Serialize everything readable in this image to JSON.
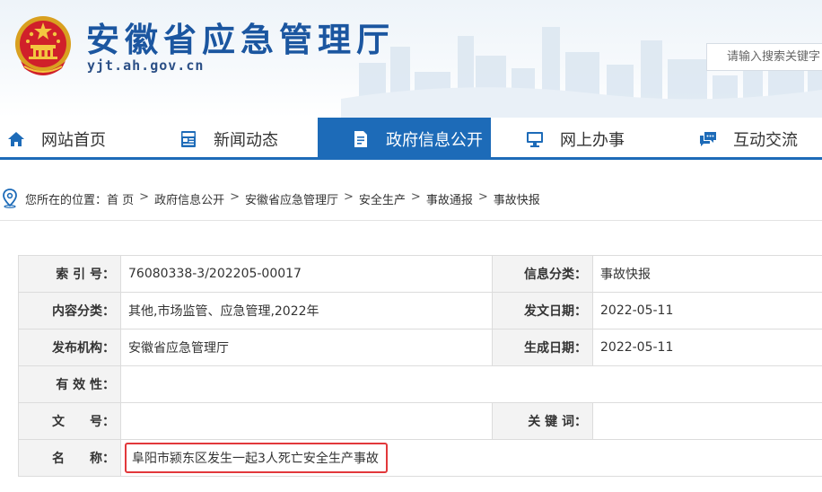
{
  "header": {
    "title": "安徽省应急管理厅",
    "domain": "yjt.ah.gov.cn",
    "search_placeholder": "请输入搜索关键字"
  },
  "nav": {
    "items": [
      {
        "label": "网站首页",
        "icon": "home-icon",
        "active": false
      },
      {
        "label": "新闻动态",
        "icon": "news-icon",
        "active": false
      },
      {
        "label": "政府信息公开",
        "icon": "document-icon",
        "active": true
      },
      {
        "label": "网上办事",
        "icon": "monitor-icon",
        "active": false
      },
      {
        "label": "互动交流",
        "icon": "chat-icon",
        "active": false
      }
    ],
    "accent_color": "#1d6bb8"
  },
  "breadcrumb": {
    "prefix": "您所在的位置：",
    "items": [
      "首 页",
      "政府信息公开",
      "安徽省应急管理厅",
      "安全生产",
      "事故通报",
      "事故快报"
    ]
  },
  "info": {
    "index_label": "索 引 号",
    "index_value": "76080338-3/202205-00017",
    "category_label": "信息分类",
    "category_value": "事故快报",
    "content_label": "内容分类",
    "content_value": "其他,市场监管、应急管理,2022年",
    "issue_date_label": "发文日期",
    "issue_date_value": "2022-05-11",
    "publisher_label": "发布机构",
    "publisher_value": "安徽省应急管理厅",
    "created_label": "生成日期",
    "created_value": "2022-05-11",
    "validity_label": "有 效 性",
    "validity_value": "",
    "docno_label": "文　　号",
    "docno_value": "",
    "keywords_label": "关 键 词",
    "keywords_value": "",
    "name_label": "名　　称",
    "name_value": "阜阳市颍东区发生一起3人死亡安全生产事故",
    "colon": "："
  },
  "highlight_color": "#e2383b"
}
